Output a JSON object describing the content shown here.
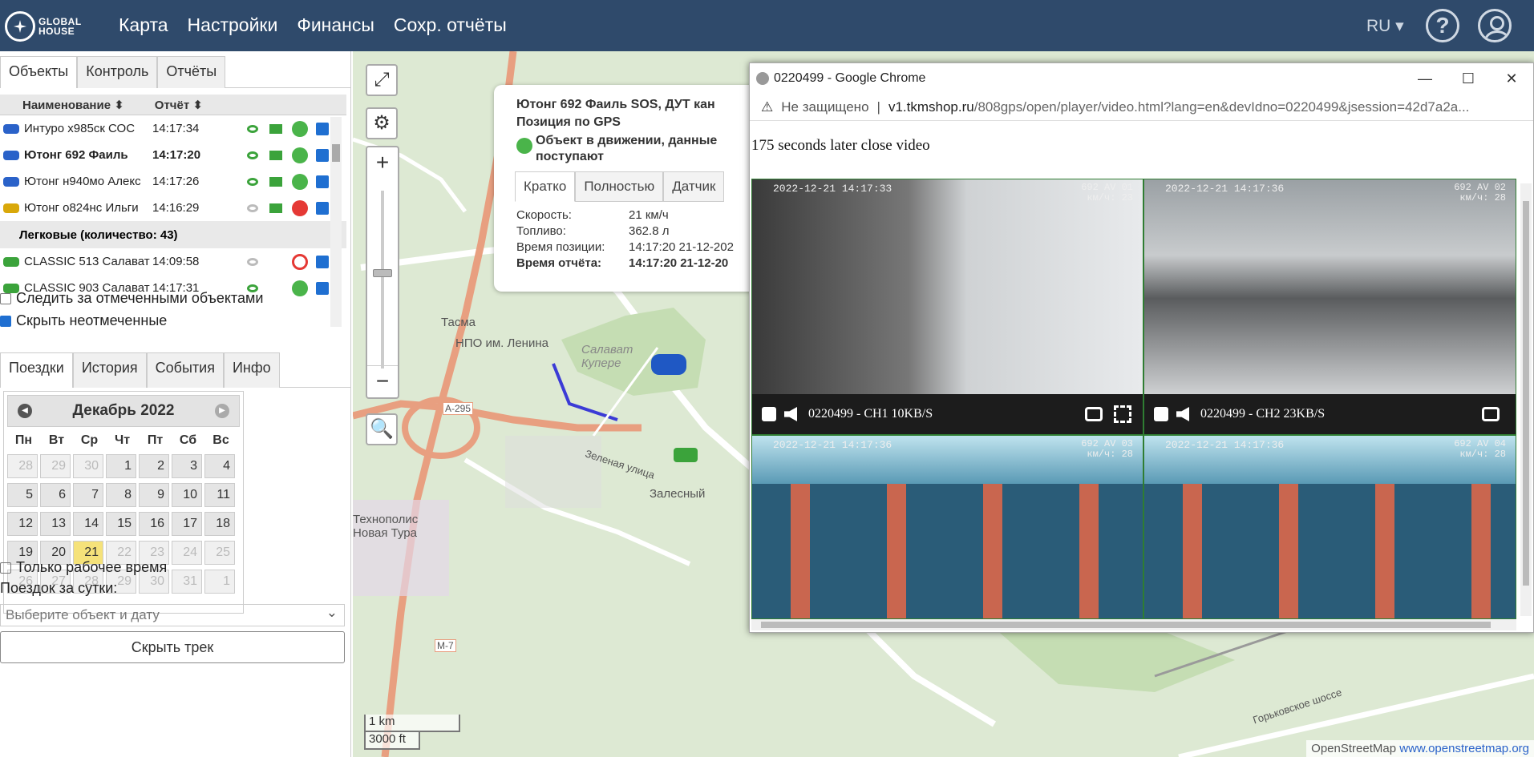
{
  "header": {
    "logo_line1": "GLOBAL",
    "logo_line2": "HOUSE",
    "nav": [
      "Карта",
      "Настройки",
      "Финансы",
      "Сохр. отчёты"
    ],
    "lang": "RU ▾"
  },
  "left": {
    "tabs": [
      "Объекты",
      "Контроль",
      "Отчёты"
    ],
    "list_headers": {
      "name": "Наименование ⬍",
      "report": "Отчёт ⬍"
    },
    "rows": [
      {
        "name": "Интуро х985ск СОС",
        "time": "14:17:34",
        "status": "green",
        "type": "blue"
      },
      {
        "name": "Ютонг 692 Фаиль",
        "time": "14:17:20",
        "status": "green",
        "type": "blue"
      },
      {
        "name": "Ютонг н940мо Алекс",
        "time": "14:17:26",
        "status": "green",
        "type": "blue"
      },
      {
        "name": "Ютонг о824нс Ильги",
        "time": "14:16:29",
        "status": "red",
        "type": "yellow"
      }
    ],
    "group": "Легковые (количество: 43)",
    "rows2": [
      {
        "name": "CLASSIC 513 Салават",
        "time": "14:09:58"
      },
      {
        "name": "CLASSIC 903 Салават",
        "time": "14:17:31"
      }
    ],
    "opt_follow": "Следить за отмеченными объектами",
    "opt_hide": "Скрыть неотмеченные",
    "tabs2": [
      "Поездки",
      "История",
      "События",
      "Инфо"
    ],
    "calendar": {
      "month": "Декабрь 2022",
      "dows": [
        "Пн",
        "Вт",
        "Ср",
        "Чт",
        "Пт",
        "Сб",
        "Вс"
      ],
      "days": [
        "28",
        "29",
        "30",
        "1",
        "2",
        "3",
        "4",
        "5",
        "6",
        "7",
        "8",
        "9",
        "10",
        "11",
        "12",
        "13",
        "14",
        "15",
        "16",
        "17",
        "18",
        "19",
        "20",
        "21",
        "22",
        "23",
        "24",
        "25",
        "26",
        "27",
        "28",
        "29",
        "30",
        "31",
        "1"
      ]
    },
    "opt_worktime": "Только рабочее время",
    "trips_label": "Поездок за сутки:",
    "select_placeholder": "Выберите объект и дату",
    "hide_track": "Скрыть трек"
  },
  "map": {
    "labels": [
      "Тасма",
      "НПО им. Ленина",
      "Залесный",
      "Технополис Новая Тура",
      "Салават Купере",
      "A-295",
      "M-7",
      "Зеленая улица",
      "Горьковское шоссе"
    ],
    "scale_km": "1 km",
    "scale_ft": "3000 ft",
    "attribution": "OpenStreetMap",
    "attribution_link": "www.openstreetmap.org"
  },
  "popup": {
    "title": "Ютонг 692 Фаиль SOS, ДУТ кан",
    "subtitle": "Позиция по GPS",
    "status": "Объект в движении, данные поступают",
    "tabs": [
      "Кратко",
      "Полностью",
      "Датчик"
    ],
    "fields": [
      {
        "label": "Скорость:",
        "value": "21 км/ч"
      },
      {
        "label": "Топливо:",
        "value": "362.8 л"
      },
      {
        "label": "Время позиции:",
        "value": "14:17:20 21-12-202"
      },
      {
        "label": "Время отчёта:",
        "value": "14:17:20 21-12-20"
      }
    ]
  },
  "window": {
    "title": "0220499 - Google Chrome",
    "insecure": "Не защищено",
    "host": "v1.tkmshop.ru",
    "path": "/808gps/open/player/video.html?lang=en&devIdno=0220499&jsession=42d7a2a...",
    "notice": "175 seconds later close video",
    "videos": [
      {
        "ts": "2022-12-21 14:17:33",
        "tag1": "692 AV 01",
        "tag2": "км/ч:  23",
        "label": "0220499 - CH1 10KB/S"
      },
      {
        "ts": "2022-12-21 14:17:36",
        "tag1": "692 AV 02",
        "tag2": "км/ч:  28",
        "label": "0220499 - CH2 23KB/S"
      },
      {
        "ts": "2022-12-21 14:17:36",
        "tag1": "692 AV 03",
        "tag2": "км/ч:  28",
        "label": ""
      },
      {
        "ts": "2022-12-21 14:17:36",
        "tag1": "692 AV 04",
        "tag2": "км/ч:  28",
        "label": ""
      }
    ]
  }
}
